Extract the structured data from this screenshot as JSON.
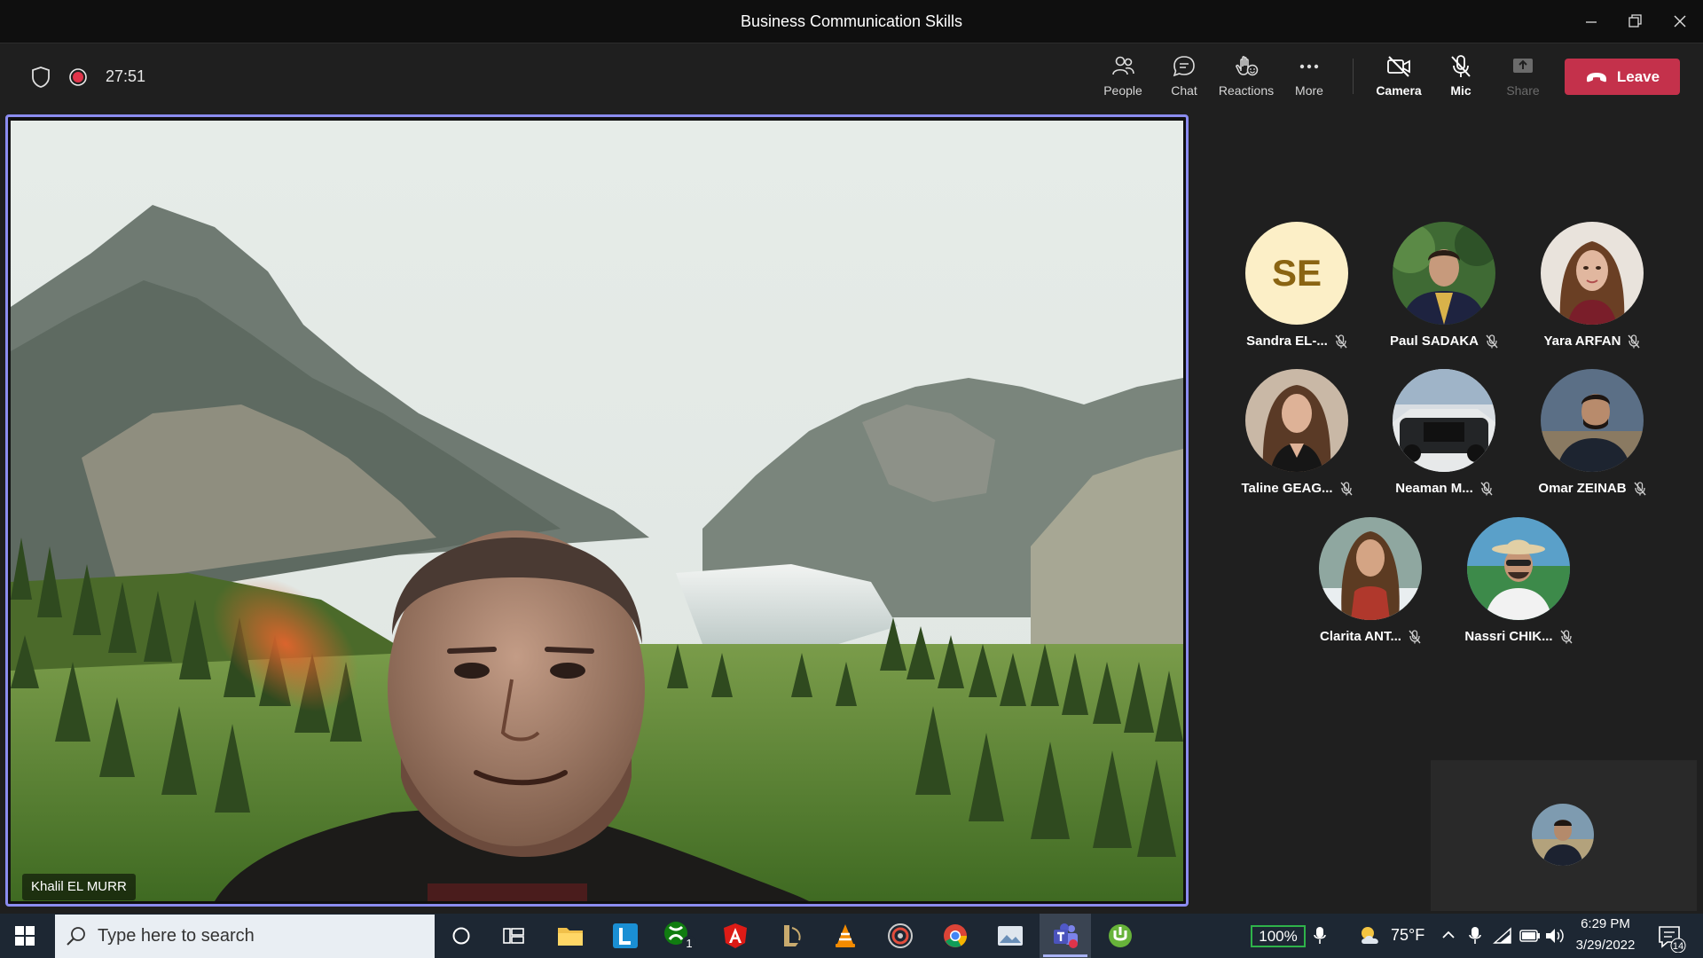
{
  "window": {
    "title": "Business Communication Skills"
  },
  "meeting": {
    "timer": "27:51",
    "toolbar": {
      "people": "People",
      "chat": "Chat",
      "reactions": "Reactions",
      "more": "More",
      "camera": "Camera",
      "mic": "Mic",
      "share": "Share",
      "leave": "Leave"
    },
    "speaker": "Khalil EL MURR",
    "participants": [
      {
        "name": "Sandra EL-...",
        "initials": "SE"
      },
      {
        "name": "Paul SADAKA"
      },
      {
        "name": "Yara ARFAN"
      },
      {
        "name": "Taline GEAG..."
      },
      {
        "name": "Neaman M..."
      },
      {
        "name": "Omar ZEINAB"
      },
      {
        "name": "Clarita ANT..."
      },
      {
        "name": "Nassri CHIK..."
      }
    ]
  },
  "taskbar": {
    "search_placeholder": "Type here to search",
    "battery": "100%",
    "temperature": "75°F",
    "time": "6:29 PM",
    "date": "3/29/2022",
    "notifications": "14",
    "xbox_badge": "1"
  },
  "colors": {
    "accent": "#8b8cf0",
    "leave": "#c4314b",
    "avatar_initials_bg": "#fcefc7",
    "avatar_initials_fg": "#8a6412"
  }
}
